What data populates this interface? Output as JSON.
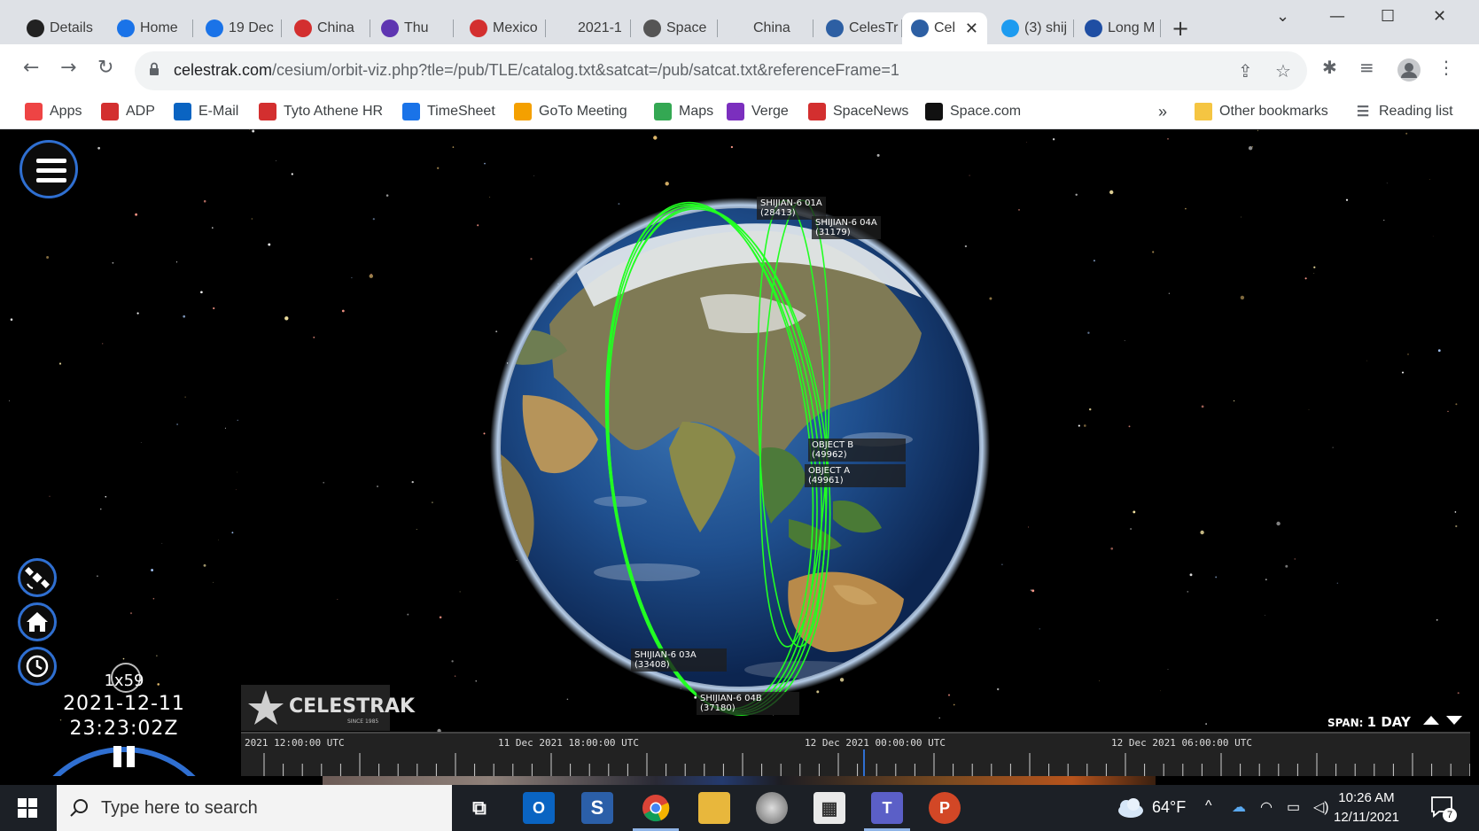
{
  "browser": {
    "tabs": [
      {
        "title": "Details",
        "icon": "document-icon",
        "color": "#222222"
      },
      {
        "title": "Home",
        "icon": "c-logo-icon",
        "color": "#1a73e8"
      },
      {
        "title": "19 Dec",
        "icon": "c-logo-icon",
        "color": "#1a73e8"
      },
      {
        "title": "China",
        "icon": "sn-logo-icon",
        "color": "#d32f2f"
      },
      {
        "title": "Thu",
        "icon": "podcast-icon",
        "color": "#5e35b1"
      },
      {
        "title": "Mexico",
        "icon": "sn-logo-icon",
        "color": "#d32f2f"
      },
      {
        "title": "2021-1",
        "icon": "blank-icon",
        "color": "#dee1e6"
      },
      {
        "title": "Space",
        "icon": "globe-icon",
        "color": "#555555"
      },
      {
        "title": "China",
        "icon": "blank-icon",
        "color": "#dee1e6"
      },
      {
        "title": "CelesTr",
        "icon": "celestrak-icon",
        "color": "#2d5fa3"
      },
      {
        "title": "Cel",
        "icon": "celestrak-icon",
        "color": "#2d5fa3",
        "active": true
      },
      {
        "title": "(3) shij",
        "icon": "twitter-icon",
        "color": "#1d9bf0"
      },
      {
        "title": "Long M",
        "icon": "n-logo-icon",
        "color": "#1f4ea3"
      }
    ],
    "new_tab": "+",
    "url_domain": "celestrak.com",
    "url_path": "/cesium/orbit-viz.php?tle=/pub/TLE/catalog.txt&satcat=/pub/satcat.txt&referenceFrame=1"
  },
  "bookmarks": {
    "items": [
      {
        "label": "Apps",
        "icon": "apps-grid-icon"
      },
      {
        "label": "ADP",
        "icon": "adp-icon"
      },
      {
        "label": "E-Mail",
        "icon": "outlook-icon"
      },
      {
        "label": "Tyto Athene HR",
        "icon": "adp-icon"
      },
      {
        "label": "TimeSheet",
        "icon": "timesheet-icon"
      },
      {
        "label": "GoTo Meeting",
        "icon": "goto-icon"
      },
      {
        "label": "Maps",
        "icon": "maps-pin-icon"
      },
      {
        "label": "Verge",
        "icon": "verge-icon"
      },
      {
        "label": "SpaceNews",
        "icon": "sn-logo-icon"
      },
      {
        "label": "Space.com",
        "icon": "space-com-icon"
      }
    ],
    "overflow": "»",
    "other": "Other bookmarks",
    "reading_list": "Reading list"
  },
  "viewer": {
    "satellites": [
      {
        "name": "SHIJIAN-6 01A",
        "id": "(28413)"
      },
      {
        "name": "SHIJIAN-6 04A",
        "id": "(31179)"
      },
      {
        "name": "OBJECT B",
        "id": "(49962)"
      },
      {
        "name": "OBJECT A",
        "id": "(49961)"
      },
      {
        "name": "SHIJIAN-6 03A",
        "id": "(33408)"
      },
      {
        "name": "SHIJIAN-6 04B",
        "id": "(37180)"
      }
    ],
    "clock": {
      "speed": "1x59",
      "date": "2021-12-11",
      "time": "23:23:02Z"
    },
    "logo": {
      "text": "CELESTRAK",
      "sub": "SINCE 1985"
    },
    "span": {
      "label": "SPAN:",
      "value": "1 DAY"
    },
    "timeline": {
      "labels": [
        "2021 12:00:00 UTC",
        "11 Dec 2021 18:00:00 UTC",
        "12 Dec 2021 00:00:00 UTC",
        "12 Dec 2021 06:00:00 UTC"
      ]
    },
    "orbit_color": "#22ff22"
  },
  "taskbar": {
    "search_placeholder": "Type here to search",
    "weather": "64°F",
    "time": "10:26 AM",
    "date": "12/11/2021",
    "notifications": "7"
  }
}
